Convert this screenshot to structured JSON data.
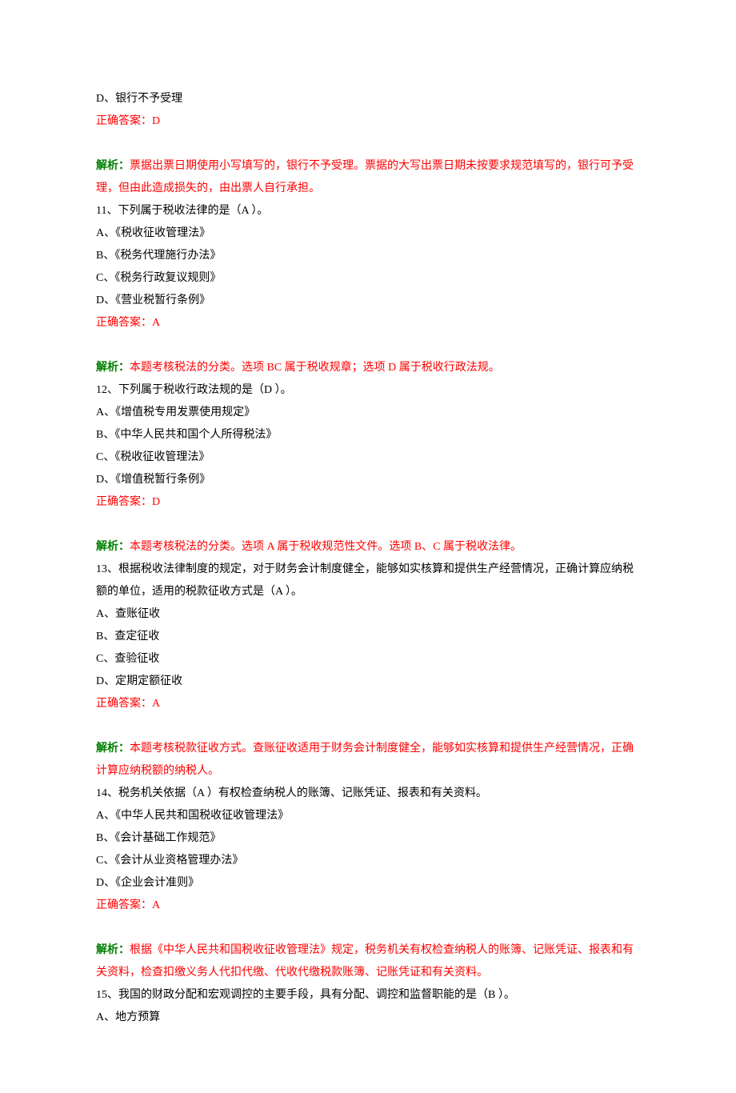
{
  "q10_tail": {
    "option_d": "D、银行不予受理",
    "answer": "正确答案：D",
    "jiexi_label": "解析：",
    "jiexi_text": "票据出票日期使用小写填写的，银行不予受理。票据的大写出票日期未按要求规范填写的，银行可予受理，但由此造成损失的，由出票人自行承担。"
  },
  "q11": {
    "stem": "11、下列属于税收法律的是（A ）。",
    "a": "A、《税收征收管理法》",
    "b": "B、《税务代理施行办法》",
    "c": "C、《税务行政复议规则》",
    "d": "D、《营业税暂行条例》",
    "answer": "正确答案：A",
    "jiexi_label": "解析：",
    "jiexi_text": "本题考核税法的分类。选项 BC 属于税收规章；选项 D 属于税收行政法规。"
  },
  "q12": {
    "stem": "12、下列属于税收行政法规的是（D ）。",
    "a": "A、《增值税专用发票使用规定》",
    "b": "B、《中华人民共和国个人所得税法》",
    "c": "C、《税收征收管理法》",
    "d": "D、《增值税暂行条例》",
    "answer": "正确答案：D",
    "jiexi_label": "解析：",
    "jiexi_text": "本题考核税法的分类。选项 A 属于税收规范性文件。选项 B、C 属于税收法律。"
  },
  "q13": {
    "stem": "13、根据税收法律制度的规定，对于财务会计制度健全，能够如实核算和提供生产经营情况，正确计算应纳税额的单位，适用的税款征收方式是（A ）。",
    "a": "A、查账征收",
    "b": "B、查定征收",
    "c": "C、查验征收",
    "d": "D、定期定额征收",
    "answer": "正确答案：A",
    "jiexi_label": "解析：",
    "jiexi_text": "本题考核税款征收方式。查账征收适用于财务会计制度健全，能够如实核算和提供生产经营情况，正确计算应纳税额的纳税人。"
  },
  "q14": {
    "stem": "14、税务机关依据（A ）有权检查纳税人的账簿、记账凭证、报表和有关资料。",
    "a": "A、《中华人民共和国税收征收管理法》",
    "b": "B、《会计基础工作规范》",
    "c": "C、《会计从业资格管理办法》",
    "d": "D、《企业会计准则》",
    "answer": "正确答案：A",
    "jiexi_label": "解析：",
    "jiexi_text": "根据《中华人民共和国税收征收管理法》规定，税务机关有权检查纳税人的账簿、记账凭证、报表和有关资料，检查扣缴义务人代扣代缴、代收代缴税款账簿、记账凭证和有关资料。"
  },
  "q15": {
    "stem": "15、我国的财政分配和宏观调控的主要手段，具有分配、调控和监督职能的是（B ）。",
    "a": "A、地方预算"
  }
}
